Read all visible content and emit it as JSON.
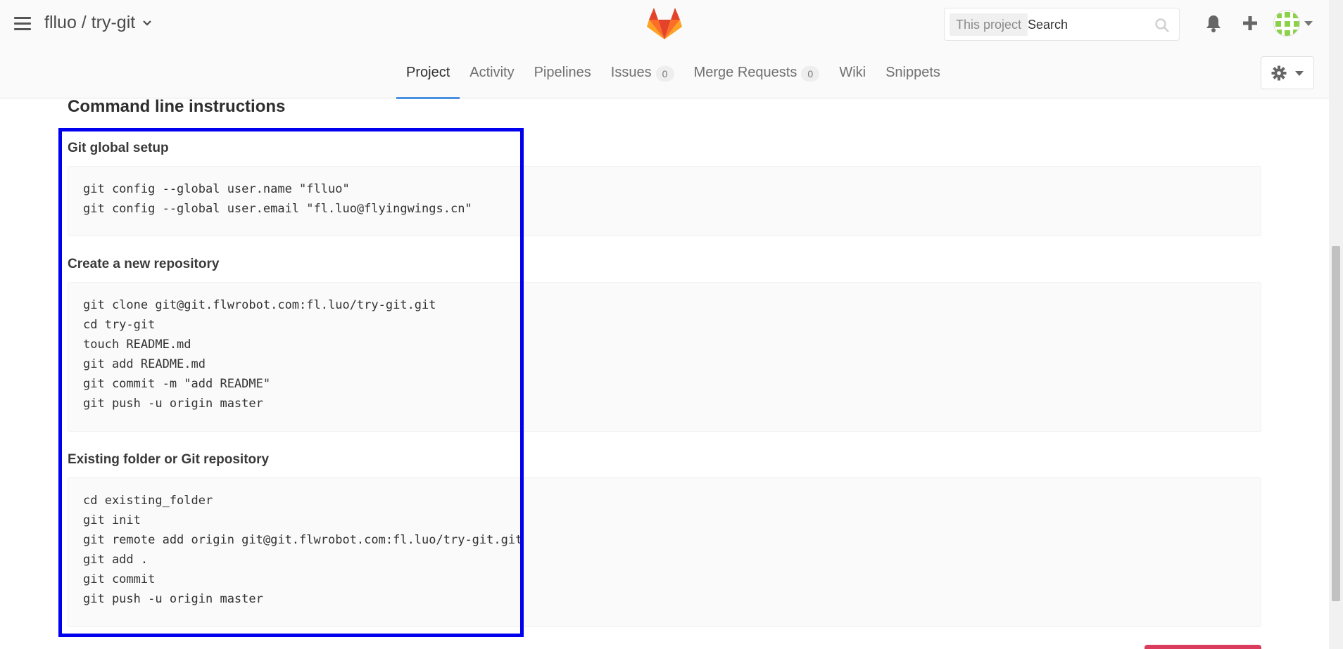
{
  "header": {
    "project_path": "flluo / try-git",
    "search_scope": "This project",
    "search_placeholder": "Search"
  },
  "nav": {
    "tabs": [
      {
        "label": "Project",
        "active": true
      },
      {
        "label": "Activity"
      },
      {
        "label": "Pipelines"
      },
      {
        "label": "Issues",
        "count": "0"
      },
      {
        "label": "Merge Requests",
        "count": "0"
      },
      {
        "label": "Wiki"
      },
      {
        "label": "Snippets"
      }
    ]
  },
  "content": {
    "title": "Command line instructions",
    "sections": [
      {
        "title": "Git global setup",
        "lines": [
          "git config --global user.name \"flluo\"",
          "git config --global user.email \"fl.luo@flyingwings.cn\""
        ]
      },
      {
        "title": "Create a new repository",
        "lines": [
          "git clone git@git.flwrobot.com:fl.luo/try-git.git",
          "cd try-git",
          "touch README.md",
          "git add README.md",
          "git commit -m \"add README\"",
          "git push -u origin master"
        ]
      },
      {
        "title": "Existing folder or Git repository",
        "lines": [
          "cd existing_folder",
          "git init",
          "git remote add origin git@git.flwrobot.com:fl.luo/try-git.git",
          "git add .",
          "git commit",
          "git push -u origin master"
        ]
      }
    ]
  },
  "colors": {
    "highlight": "#0000ee",
    "nav_active_underline": "#4a90e2",
    "accent_button": "#db3b5c"
  },
  "icons": [
    "hamburger-icon",
    "chevron-down-icon",
    "gitlab-logo",
    "search-icon",
    "bell-icon",
    "plus-icon",
    "avatar",
    "gear-icon",
    "caret-down-icon"
  ]
}
